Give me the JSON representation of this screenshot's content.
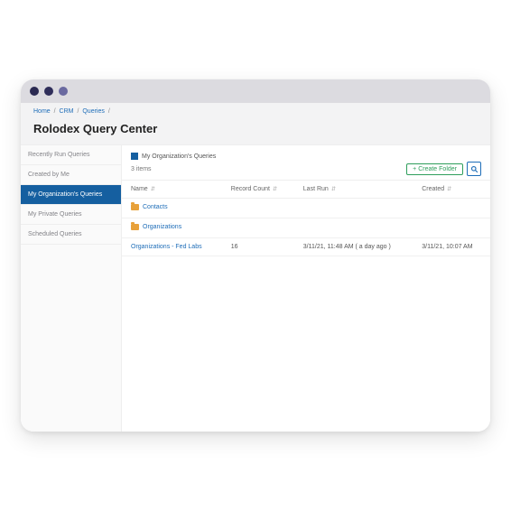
{
  "breadcrumb": {
    "home": "Home",
    "crm": "CRM",
    "queries": "Queries"
  },
  "page_title": "Rolodex Query Center",
  "sidebar": {
    "items": [
      {
        "label": "Recently Run Queries",
        "active": false
      },
      {
        "label": "Created by Me",
        "active": false
      },
      {
        "label": "My Organization's Queries",
        "active": true
      },
      {
        "label": "My Private Queries",
        "active": false
      },
      {
        "label": "Scheduled Queries",
        "active": false
      }
    ]
  },
  "main": {
    "folder_crumb": "My Organization's Queries",
    "item_count": "3 items",
    "create_label": "+ Create Folder",
    "columns": {
      "name": "Name",
      "record_count": "Record Count",
      "last_run": "Last Run",
      "created": "Created"
    },
    "rows": [
      {
        "type": "folder",
        "name": "Contacts",
        "record_count": "",
        "last_run": "",
        "created": ""
      },
      {
        "type": "folder",
        "name": "Organizations",
        "record_count": "",
        "last_run": "",
        "created": ""
      },
      {
        "type": "query",
        "name": "Organizations - Fed Labs",
        "record_count": "16",
        "last_run": "3/11/21, 11:48 AM ( a day ago )",
        "created": "3/11/21, 10:07 AM"
      }
    ]
  }
}
